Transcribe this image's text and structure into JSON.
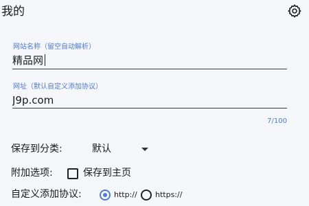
{
  "header": {
    "title": "我的",
    "settings_icon": "gear-icon"
  },
  "form": {
    "site_name": {
      "label": "网站名称（留空自动解析）",
      "value": "精品网"
    },
    "site_url": {
      "label": "网址（默认自定义添加协议）",
      "value": "J9p.com",
      "char_count": "7/100"
    }
  },
  "options": {
    "category_label": "保存到分类:",
    "category_value": "默认",
    "extra_label": "附加选项:",
    "save_to_home_label": "保存到主页",
    "save_to_home_checked": false,
    "protocol_label": "自定义添加协议:",
    "protocols": [
      {
        "label": "http://",
        "selected": true
      },
      {
        "label": "https://",
        "selected": false
      }
    ]
  },
  "colors": {
    "accent": "#4f7bd8",
    "background": "#f5f6fa",
    "text": "#1a1a1a"
  }
}
